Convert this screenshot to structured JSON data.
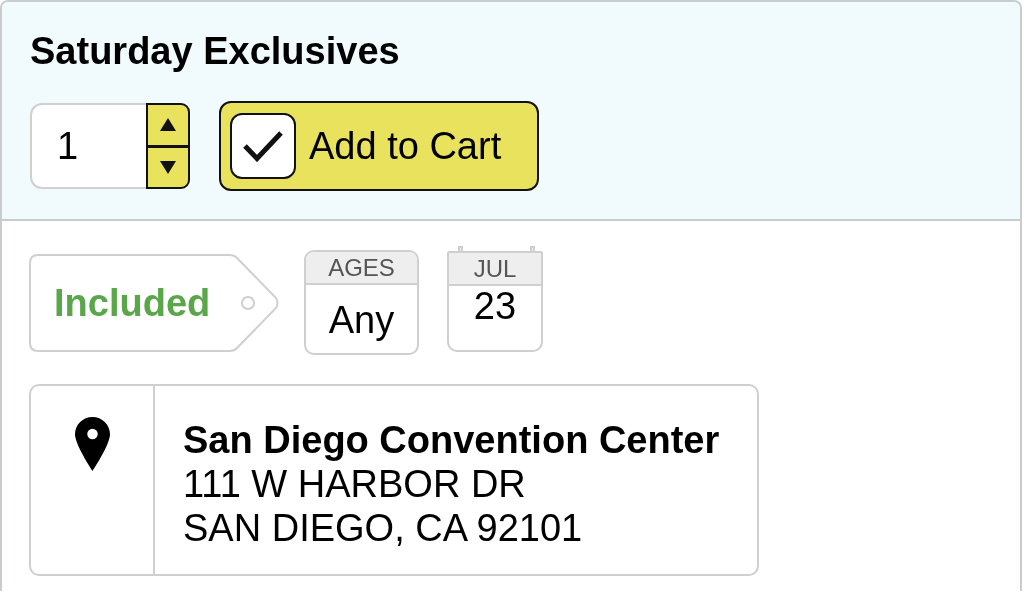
{
  "section": {
    "title": "Saturday Exclusives"
  },
  "quantity": {
    "value": "1"
  },
  "add_to_cart": {
    "label": "Add to Cart",
    "checked": true
  },
  "tag": {
    "label": "Included"
  },
  "ages": {
    "header": "AGES",
    "value": "Any"
  },
  "date": {
    "month": "JUL",
    "day": "23"
  },
  "location": {
    "name": "San Diego Convention Center",
    "address_lines": [
      "111 W HARBOR DR",
      "SAN DIEGO, CA 92101"
    ]
  }
}
